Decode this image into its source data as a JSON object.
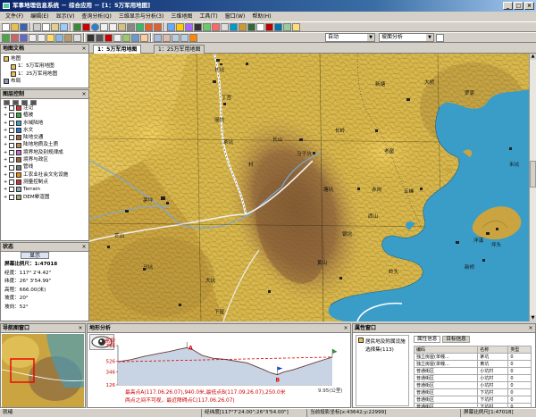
{
  "window": {
    "title": "军事地理信息系统 － 综合应用 － [1：5万军用地图]",
    "min": "_",
    "max": "□",
    "close": "×"
  },
  "menu": [
    "文件(F)",
    "编辑(E)",
    "显示(V)",
    "查询分析(Q)",
    "三维显示与分析(3)",
    "三维地图",
    "工具(T)",
    "窗口(W)",
    "帮助(H)"
  ],
  "toolbar": {
    "combo_auto": "自动",
    "combo_analysis": "坡面分析"
  },
  "doc_panel": {
    "title": "地图文档",
    "items": [
      "地图",
      "1：5万军用地图",
      "1：25万军用地图",
      "布局"
    ]
  },
  "layer_panel": {
    "title": "图层控制",
    "items": [
      "注记",
      "植被",
      "水域陆地",
      "水文",
      "陆地交通",
      "陆地地质及土质",
      "境界地及别规律成",
      "境界与政区",
      "管线",
      "工农业社会文化设施",
      "测量控制点",
      "Terrain",
      "DEM晕渲图"
    ]
  },
  "status_panel": {
    "title": "状态",
    "tab": "显示",
    "lines": [
      "屏幕比例尺：1:47018",
      "经度：117° 2'4.42\"",
      "纬度：26° 3'54.99\"",
      "高程：666.00(米)",
      "坡度：20°",
      "坡向：52°"
    ]
  },
  "nav_panel": {
    "title": "导航图窗口"
  },
  "tabs": [
    "1：5万军用地图",
    "1：25万军用地图"
  ],
  "map": {
    "labels": [
      "长坑",
      "丁宫",
      "瑶坑",
      "茶坑",
      "长山",
      "马子坑",
      "长岭",
      "老屋",
      "五峰",
      "赤岗",
      "塘坑",
      "银坑",
      "西山",
      "岭头",
      "村",
      "茅坪",
      "芒山",
      "马坑",
      "大坑",
      "黄山",
      "新塘",
      "大桥",
      "罗家",
      "坪头",
      "新桥",
      "禾坑",
      "洋溪",
      "下屋"
    ]
  },
  "profile_panel": {
    "title": "地形分析",
    "y_title": "高程",
    "y_ticks": [
      "796",
      "526",
      "346",
      "126"
    ],
    "x_end": "9.95(公里)",
    "marker_a": "A",
    "marker_b": "B",
    "info1": "最高点A(117.06.26.07),940.0米,最低点B(117.09.26.07),250.0米",
    "info2": "两点之间不可视，最近障碍点C(117.06.26.07)"
  },
  "chart_data": {
    "type": "line",
    "title": "",
    "xlabel": "",
    "ylabel": "高程",
    "x_end_label": "9.95(公里)",
    "y_ticks": [
      796,
      526,
      346,
      126
    ],
    "ylim": [
      126,
      796
    ],
    "xlim": [
      0,
      9.95
    ],
    "series": [
      {
        "values": [
          [
            0,
            520
          ],
          [
            0.6,
            555
          ],
          [
            1.2,
            610
          ],
          [
            1.8,
            655
          ],
          [
            2.4,
            695
          ],
          [
            2.8,
            730
          ],
          [
            3.2,
            760
          ],
          [
            3.5,
            720
          ],
          [
            3.9,
            630
          ],
          [
            4.4,
            580
          ],
          [
            5.0,
            560
          ],
          [
            5.5,
            530
          ],
          [
            6.0,
            500
          ],
          [
            6.4,
            440
          ],
          [
            6.8,
            380
          ],
          [
            7.1,
            330
          ],
          [
            7.4,
            300
          ],
          [
            7.7,
            345
          ],
          [
            8.1,
            380
          ],
          [
            8.6,
            440
          ],
          [
            9.1,
            500
          ],
          [
            9.6,
            560
          ],
          [
            9.95,
            600
          ]
        ]
      },
      {
        "values": [
          [
            0,
            520
          ],
          [
            9.95,
            600
          ]
        ]
      }
    ]
  },
  "attr_panel": {
    "title": "属性窗口",
    "query_title": "居民地及附属设施",
    "query_sub": "选择集(113)",
    "tabs": [
      "属性信息",
      "目标信息"
    ],
    "headers": [
      "编码",
      "名称",
      "类型"
    ],
    "rows": [
      [
        "独立房屋(单幢...",
        "茅坑",
        "0"
      ],
      [
        "独立房屋(单幢...",
        "黄坑",
        "0"
      ],
      [
        "普通街区",
        "小坑村",
        "0"
      ],
      [
        "普通街区",
        "小坑村",
        "0"
      ],
      [
        "普通街区",
        "小坑村",
        "0"
      ],
      [
        "普通街区",
        "下坑村",
        "0"
      ],
      [
        "普通街区",
        "下坑村",
        "0"
      ],
      [
        "普通街区",
        "下坑村",
        "0"
      ]
    ]
  },
  "statusbar": {
    "ready": "就绪",
    "coords": "经纬度[117°7'24.00\";26°3'54.00\"]",
    "proj": "当前投影坐标[x:43642;y:22999]",
    "scale": "屏幕比例尺[1:47018]"
  }
}
